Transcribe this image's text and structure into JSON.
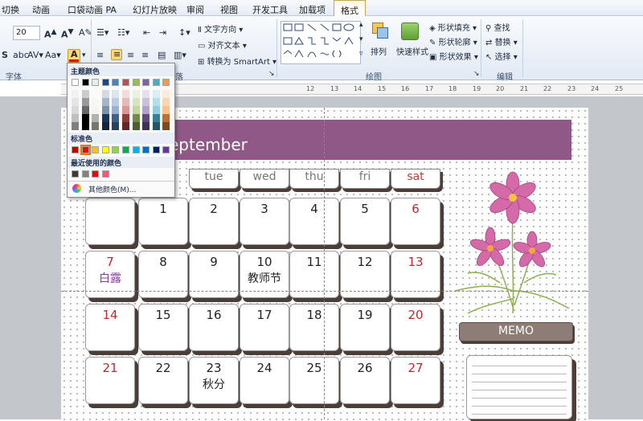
{
  "ribbon_tabs": [
    {
      "label": "切换",
      "active": false
    },
    {
      "label": "动画",
      "active": false
    },
    {
      "label": "口袋动画 PA",
      "active": false
    },
    {
      "label": "幻灯片放映",
      "active": false
    },
    {
      "label": "审阅",
      "active": false
    },
    {
      "label": "视图",
      "active": false
    },
    {
      "label": "开发工具",
      "active": false
    },
    {
      "label": "加载项",
      "active": false
    },
    {
      "label": "格式",
      "active": true
    }
  ],
  "font_group": {
    "label": "字体",
    "font_size": "20"
  },
  "paragraph_group": {
    "label": "落",
    "text_direction": "文字方向",
    "align_text": "对齐文本",
    "convert_smartart": "转换为 SmartArt"
  },
  "drawing_group": {
    "label": "绘图",
    "arrange": "排列",
    "quick_styles": "快速样式",
    "shape_fill": "形状填充",
    "shape_outline": "形状轮廓",
    "shape_effects": "形状效果"
  },
  "editing_group": {
    "label": "编辑",
    "find": "查找",
    "replace": "替换",
    "select": "选择"
  },
  "ruler_numbers": [
    "12",
    "13",
    "14",
    "15",
    "16",
    "17",
    "18",
    "19",
    "20",
    "21",
    "22",
    "23",
    "24",
    "25"
  ],
  "color_dropdown": {
    "theme_label": "主题颜色",
    "standard_label": "标准色",
    "recent_label": "最近使用的颜色",
    "more_colors": "其他颜色(M)...",
    "theme_top": [
      "#ffffff",
      "#000000",
      "#eeece1",
      "#1f497d",
      "#4f81bd",
      "#c0504d",
      "#9bbb59",
      "#8064a2",
      "#4bacc6",
      "#f79646"
    ],
    "standard": [
      "#c00000",
      "#ff0000",
      "#ffc000",
      "#ffff00",
      "#92d050",
      "#00b050",
      "#00b0f0",
      "#0070c0",
      "#002060",
      "#7030a0"
    ],
    "recent": [
      "#3f3836",
      "#8c7e78",
      "#ff0000",
      "#f05a78"
    ],
    "selected_standard_index": 1
  },
  "calendar": {
    "month_title": "eptember",
    "weekdays": [
      "tue",
      "wed",
      "thu",
      "fri",
      "sat"
    ],
    "rows": [
      [
        {
          "day": "",
          "sub": ""
        },
        {
          "day": "1",
          "sub": ""
        },
        {
          "day": "2",
          "sub": ""
        },
        {
          "day": "3",
          "sub": ""
        },
        {
          "day": "4",
          "sub": ""
        },
        {
          "day": "5",
          "sub": ""
        },
        {
          "day": "6",
          "sub": "",
          "red": true
        }
      ],
      [
        {
          "day": "7",
          "sub": "白露",
          "red": true,
          "subPurple": true
        },
        {
          "day": "8",
          "sub": ""
        },
        {
          "day": "9",
          "sub": ""
        },
        {
          "day": "10",
          "sub": "教师节"
        },
        {
          "day": "11",
          "sub": ""
        },
        {
          "day": "12",
          "sub": ""
        },
        {
          "day": "13",
          "sub": "",
          "red": true
        }
      ],
      [
        {
          "day": "14",
          "sub": "",
          "red": true
        },
        {
          "day": "15",
          "sub": ""
        },
        {
          "day": "16",
          "sub": ""
        },
        {
          "day": "17",
          "sub": ""
        },
        {
          "day": "18",
          "sub": ""
        },
        {
          "day": "19",
          "sub": ""
        },
        {
          "day": "20",
          "sub": "",
          "red": true
        }
      ],
      [
        {
          "day": "21",
          "sub": "",
          "red": true
        },
        {
          "day": "22",
          "sub": ""
        },
        {
          "day": "23",
          "sub": "秋分"
        },
        {
          "day": "24",
          "sub": ""
        },
        {
          "day": "25",
          "sub": ""
        },
        {
          "day": "26",
          "sub": ""
        },
        {
          "day": "27",
          "sub": "",
          "red": true
        }
      ]
    ],
    "memo_label": "MEMO"
  },
  "colors": {
    "banner": "#905886",
    "cell_shadow": "#4b3e39",
    "weekend_red": "#c0282f"
  }
}
